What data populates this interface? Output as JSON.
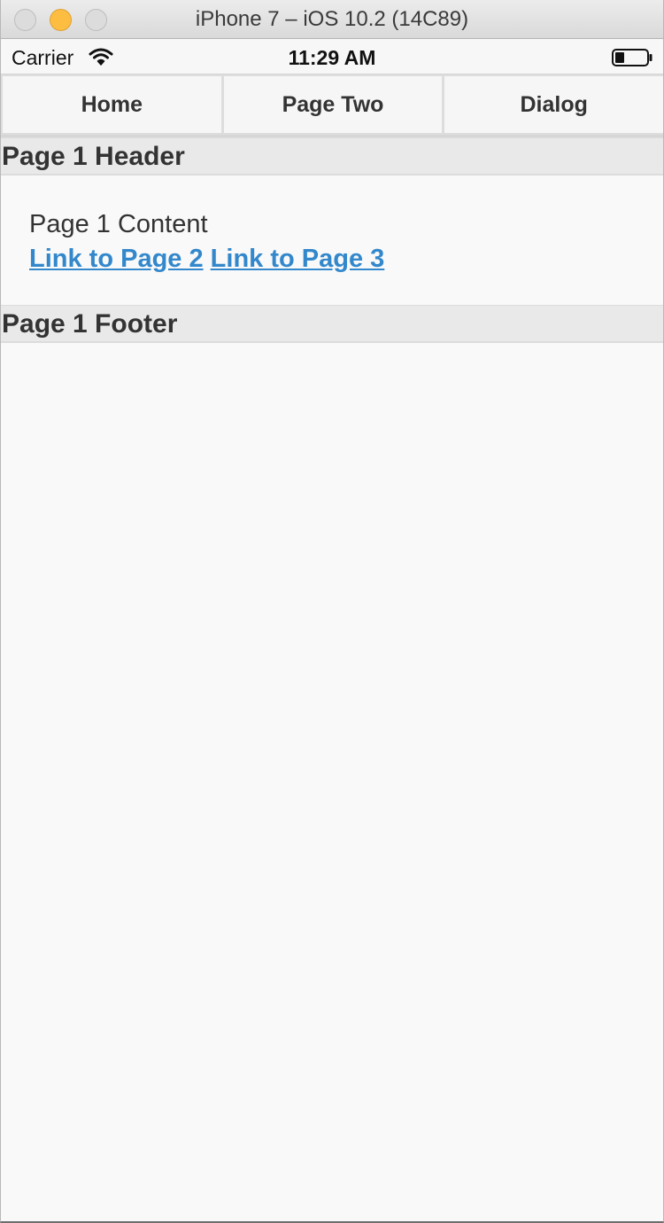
{
  "window": {
    "title": "iPhone 7 – iOS 10.2 (14C89)"
  },
  "statusbar": {
    "carrier": "Carrier",
    "time": "11:29 AM"
  },
  "navbar": {
    "items": [
      {
        "label": "Home"
      },
      {
        "label": "Page Two"
      },
      {
        "label": "Dialog"
      }
    ]
  },
  "page": {
    "header": "Page 1 Header",
    "content": "Page 1 Content",
    "links": [
      {
        "label": "Link to Page 2"
      },
      {
        "label": "Link to Page 3"
      }
    ],
    "footer": "Page 1 Footer"
  },
  "colors": {
    "link": "#3388cc",
    "bar_background": "#e9e9e9",
    "page_background": "#f9f9f9",
    "minimize_button": "#fdbd41"
  }
}
